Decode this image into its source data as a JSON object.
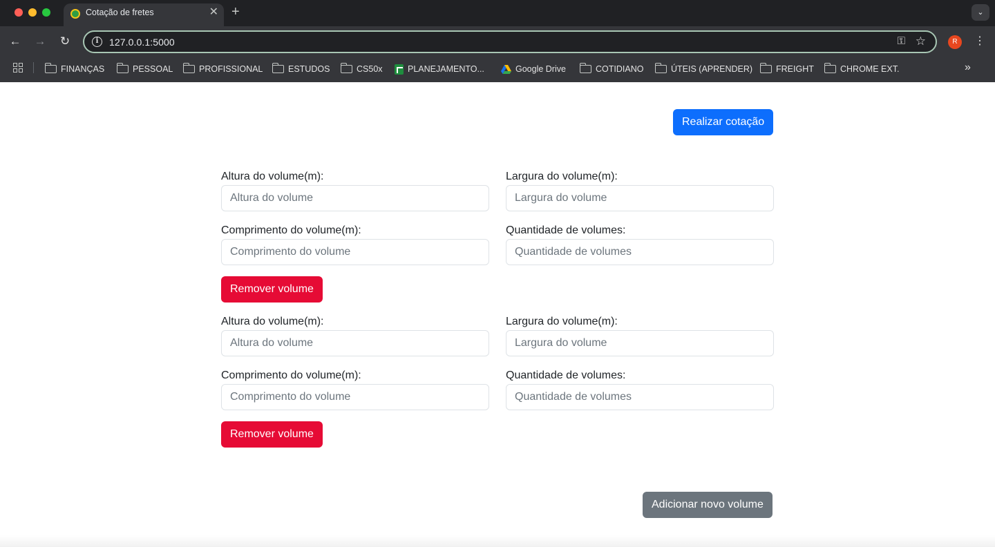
{
  "browser": {
    "tab_title": "Cotação de fretes",
    "tab_close": "✕",
    "new_tab": "+",
    "tab_menu": "⌄",
    "url": "127.0.0.1:5000",
    "profile_initial": "R",
    "bookmarks": [
      {
        "label": "FINANÇAS",
        "icon": "folder-icon"
      },
      {
        "label": "PESSOAL",
        "icon": "folder-icon"
      },
      {
        "label": "PROFISSIONAL",
        "icon": "folder-icon"
      },
      {
        "label": "ESTUDOS",
        "icon": "folder-icon"
      },
      {
        "label": "CS50x",
        "icon": "folder-icon"
      },
      {
        "label": "PLANEJAMENTO...",
        "icon": "sheets-icon"
      },
      {
        "label": "Google Drive",
        "icon": "google-drive-icon"
      },
      {
        "label": "COTIDIANO",
        "icon": "folder-icon"
      },
      {
        "label": "ÚTEIS (APRENDER)",
        "icon": "folder-icon"
      },
      {
        "label": "FREIGHT",
        "icon": "folder-icon"
      },
      {
        "label": "CHROME EXT.",
        "icon": "folder-icon"
      }
    ],
    "bookmarks_more": "»"
  },
  "page": {
    "quote_button": "Realizar cotação",
    "volumes": [
      {
        "height_label": "Altura do volume(m):",
        "height_placeholder": "Altura do volume",
        "width_label": "Largura do volume(m):",
        "width_placeholder": "Largura do volume",
        "length_label": "Comprimento do volume(m):",
        "length_placeholder": "Comprimento do volume",
        "quantity_label": "Quantidade de volumes:",
        "quantity_placeholder": "Quantidade de volumes",
        "remove_button": "Remover volume"
      },
      {
        "height_label": "Altura do volume(m):",
        "height_placeholder": "Altura do volume",
        "width_label": "Largura do volume(m):",
        "width_placeholder": "Largura do volume",
        "length_label": "Comprimento do volume(m):",
        "length_placeholder": "Comprimento do volume",
        "quantity_label": "Quantidade de volumes:",
        "quantity_placeholder": "Quantidade de volumes",
        "remove_button": "Remover volume"
      }
    ],
    "add_button": "Adicionar novo volume"
  },
  "colors": {
    "primary": "#0d6efd",
    "danger": "#e60b35",
    "secondary": "#6c757d"
  }
}
